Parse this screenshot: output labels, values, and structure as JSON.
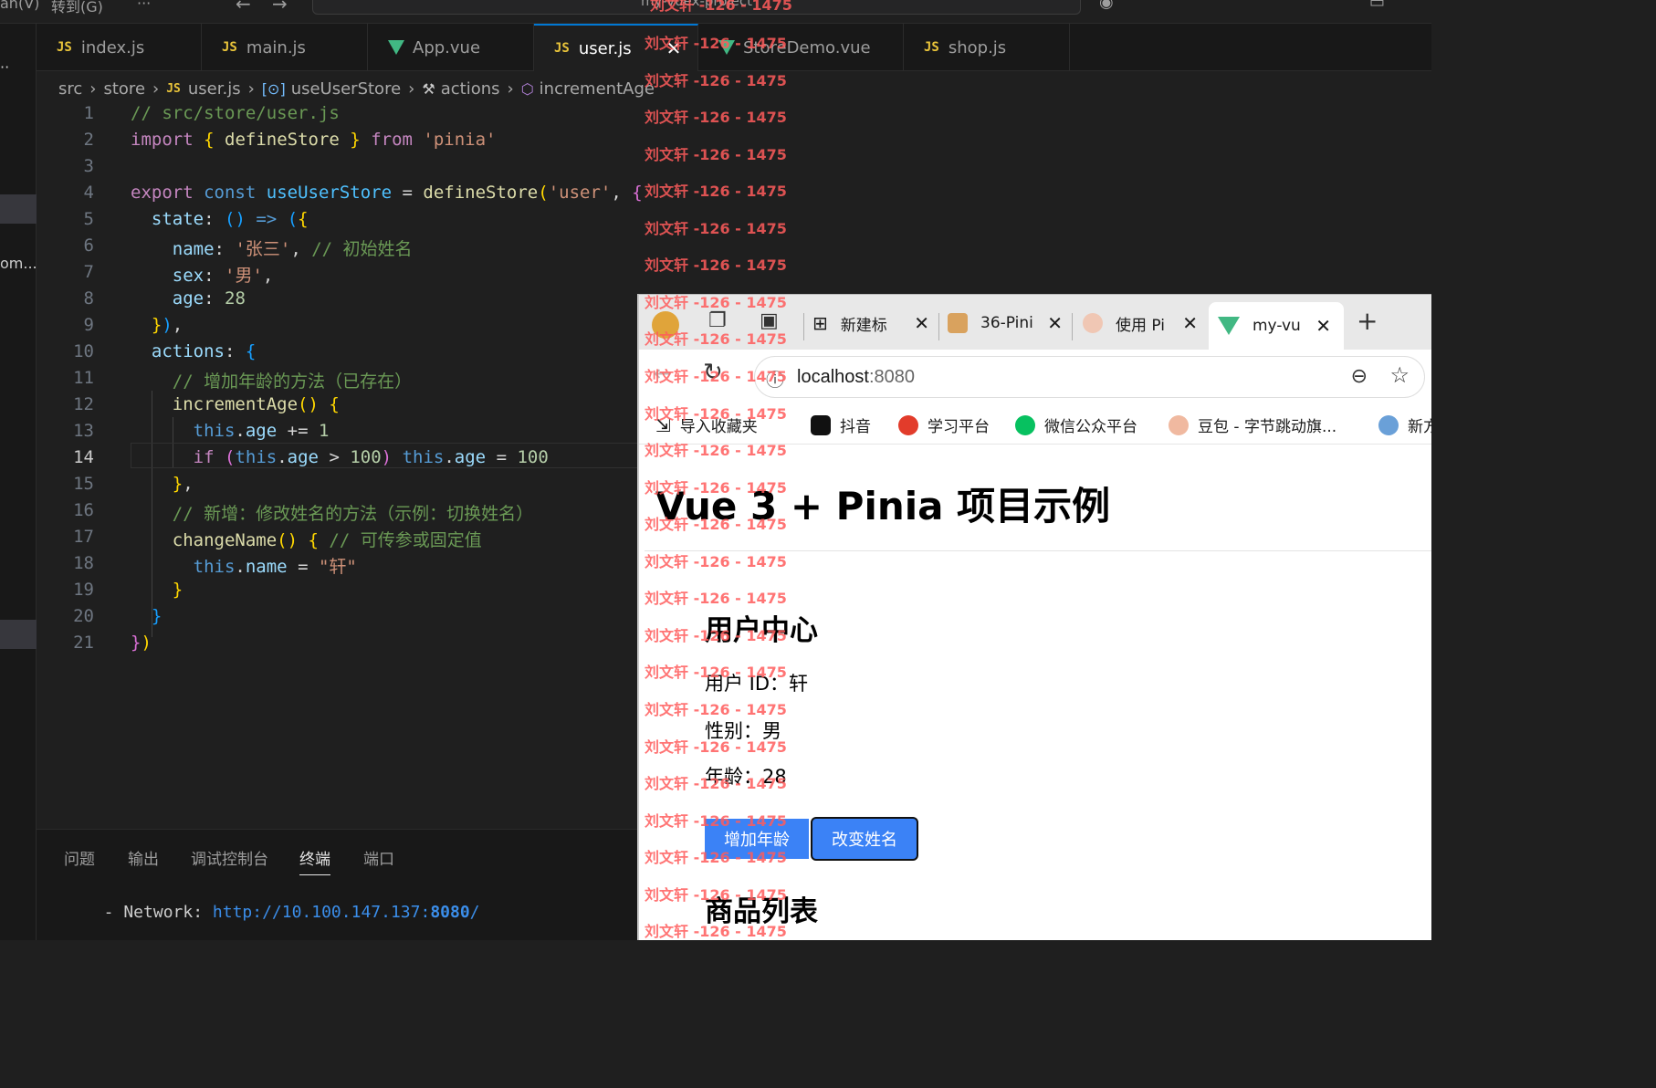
{
  "titlebar": {
    "menu_left": "an(V)",
    "menu_goto": "转到(G)",
    "more": "···",
    "search_text": "my-vuex-project"
  },
  "tabs": [
    {
      "label": "index.js",
      "kind": "js"
    },
    {
      "label": "main.js",
      "kind": "js"
    },
    {
      "label": "App.vue",
      "kind": "vue"
    },
    {
      "label": "user.js",
      "kind": "js",
      "active": true
    },
    {
      "label": "StoreDemo.vue",
      "kind": "vue"
    },
    {
      "label": "shop.js",
      "kind": "js"
    }
  ],
  "file_icon_js": "JS",
  "sidebar_trunc": "om...",
  "breadcrumb": [
    "src",
    "store",
    "user.js",
    "useUserStore",
    "actions",
    "incrementAge"
  ],
  "editor": {
    "current_line": 14,
    "lines": [
      "// src/store/user.js",
      "import { defineStore } from 'pinia'",
      "",
      "export const useUserStore = defineStore('user', {",
      "  state: () => ({",
      "    name: '张三', // 初始姓名",
      "    sex: '男',",
      "    age: 28",
      "  }),",
      "  actions: {",
      "    // 增加年龄的方法（已存在）",
      "    incrementAge() {",
      "      this.age += 1",
      "      if (this.age > 100) this.age = 100",
      "    },",
      "    // 新增：修改姓名的方法（示例：切换姓名）",
      "    changeName() { // 可传参或固定值",
      "      this.name = \"轩\"",
      "    }",
      "  }",
      "})"
    ]
  },
  "panel": {
    "tabs": [
      "问题",
      "输出",
      "调试控制台",
      "终端",
      "端口"
    ],
    "active_tab": "终端",
    "terminal_prefix": "  - Network: ",
    "terminal_url": "http://10.100.147.137:",
    "terminal_port": "8080",
    "terminal_suffix": "/"
  },
  "browser": {
    "tabs": [
      {
        "label": "新建标"
      },
      {
        "label": "36-Pini"
      },
      {
        "label": "使用 Pi"
      },
      {
        "label": "my-vu",
        "active": true
      }
    ],
    "new_tab": "+",
    "address_host": "localhost",
    "address_port": ":8080",
    "bookmarks": [
      {
        "label": "导入收藏夹",
        "color": "#555555"
      },
      {
        "label": "抖音",
        "color": "#111111"
      },
      {
        "label": "学习平台",
        "color": "#e23c2b"
      },
      {
        "label": "微信公众平台",
        "color": "#07c160"
      },
      {
        "label": "豆包 - 字节跳动旗...",
        "color": "#f0b9a0"
      },
      {
        "label": "新方",
        "color": "#6aa0d8"
      }
    ]
  },
  "app": {
    "title": "Vue 3 + Pinia 项目示例",
    "user_section": "用户中心",
    "user_id_label": "用户 ID：轩",
    "sex_label": "性别：男",
    "age_label": "年龄：28",
    "btn_increase": "增加年龄",
    "btn_rename": "改变姓名",
    "products_section": "商品列表"
  },
  "watermark": "刘文轩 -126 - 1475",
  "colors": {
    "accent": "#0078d4",
    "button_blue": "#3b82f6",
    "watermark": "#ff5c5c"
  }
}
